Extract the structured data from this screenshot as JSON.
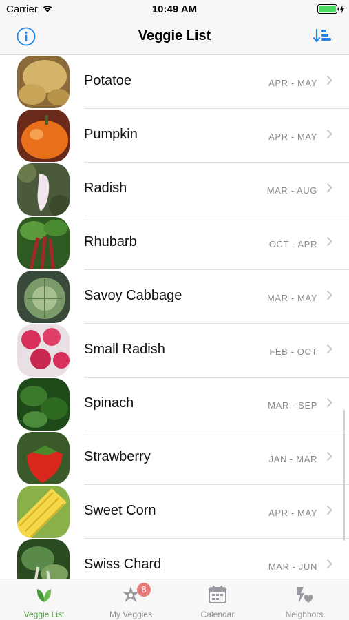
{
  "status_bar": {
    "carrier": "Carrier",
    "time": "10:49 AM"
  },
  "nav": {
    "title": "Veggie List",
    "left_icon": "info-icon",
    "right_icon": "sort-icon"
  },
  "colors": {
    "accent": "#1d86f0",
    "active_tab": "#4a9a3a",
    "badge": "#e87a7a"
  },
  "veggies": [
    {
      "name": "Potatoe",
      "season": "APR - MAY"
    },
    {
      "name": "Pumpkin",
      "season": "APR - MAY"
    },
    {
      "name": "Radish",
      "season": "MAR - AUG"
    },
    {
      "name": "Rhubarb",
      "season": "OCT - APR"
    },
    {
      "name": "Savoy Cabbage",
      "season": "MAR - MAY"
    },
    {
      "name": "Small Radish",
      "season": "FEB - OCT"
    },
    {
      "name": "Spinach",
      "season": "MAR - SEP"
    },
    {
      "name": "Strawberry",
      "season": "JAN - MAR"
    },
    {
      "name": "Sweet Corn",
      "season": "APR - MAY"
    },
    {
      "name": "Swiss Chard",
      "season": "MAR - JUN"
    }
  ],
  "tabs": [
    {
      "label": "Veggie List",
      "icon": "leaf-icon",
      "active": true
    },
    {
      "label": "My Veggies",
      "icon": "veggie-icon",
      "badge": "8"
    },
    {
      "label": "Calendar",
      "icon": "calendar-icon"
    },
    {
      "label": "Neighbors",
      "icon": "neighbors-icon"
    }
  ]
}
